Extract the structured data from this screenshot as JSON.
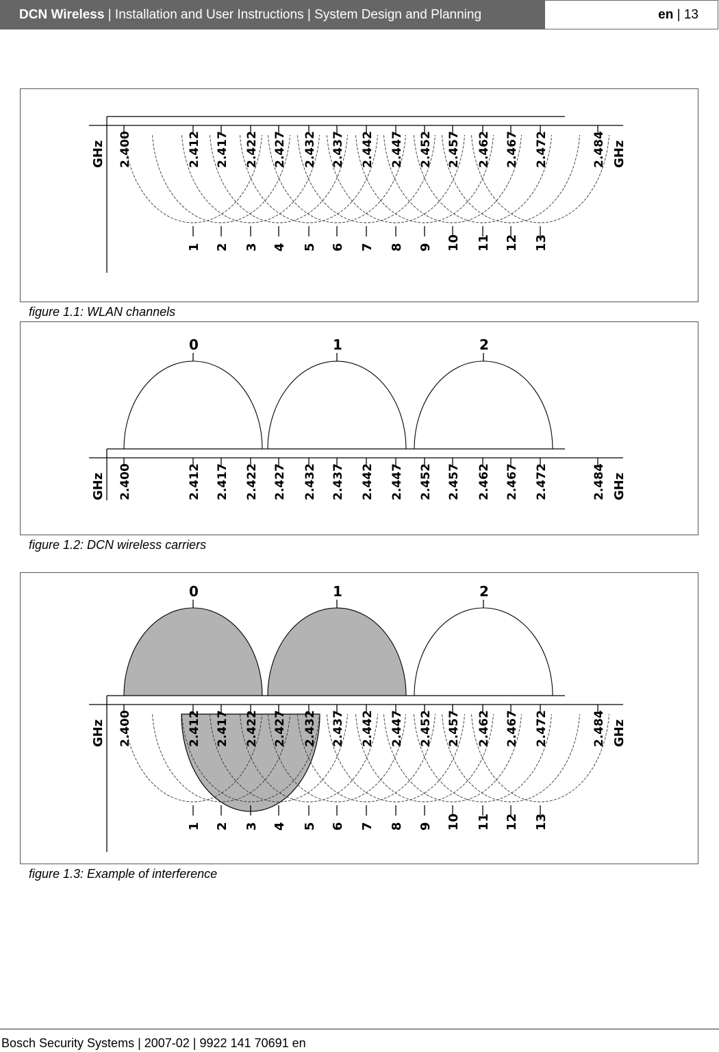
{
  "header": {
    "product": "DCN Wireless",
    "section": " | Installation and User Instructions | System Design and Planning",
    "lang": "en",
    "page": " | 13"
  },
  "diagram": {
    "unit_label": "GHz",
    "frequencies": [
      "2.400",
      "2.412",
      "2.417",
      "2.422",
      "2.427",
      "2.432",
      "2.437",
      "2.442",
      "2.447",
      "2.452",
      "2.457",
      "2.462",
      "2.467",
      "2.472",
      "2.484"
    ],
    "wlan_channels": [
      "1",
      "2",
      "3",
      "4",
      "5",
      "6",
      "7",
      "8",
      "9",
      "10",
      "11",
      "12",
      "13"
    ],
    "dcn_carriers": [
      "0",
      "1",
      "2"
    ],
    "interference": {
      "shaded_carriers": [
        "0",
        "1"
      ],
      "shaded_wlan_channel": "3",
      "shade_color": "#b3b3b3"
    }
  },
  "figures": [
    {
      "caption": "figure 1.1: WLAN channels"
    },
    {
      "caption": "figure 1.2: DCN wireless carriers"
    },
    {
      "caption": "figure 1.3: Example of interference"
    }
  ],
  "footer": {
    "text": "Bosch Security Systems | 2007-02 | 9922 141 70691 en"
  }
}
